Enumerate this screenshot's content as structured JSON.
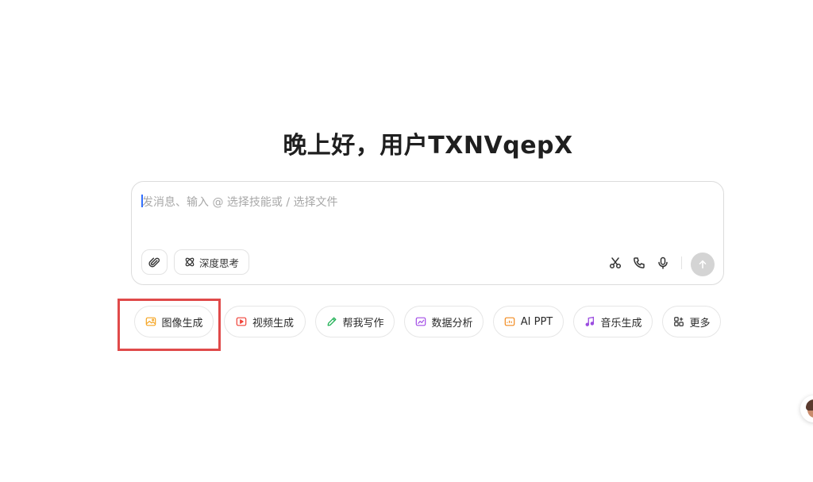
{
  "greeting": "晚上好，用户TXNVqepX",
  "composer": {
    "placeholder": "发消息、输入 @ 选择技能或 / 选择文件",
    "attach_icon": "paperclip-icon",
    "deep_think": {
      "label": "深度思考",
      "icon": "atom-icon"
    },
    "tools": [
      "scissors-icon",
      "phone-icon",
      "microphone-icon"
    ],
    "send_icon": "arrow-up-icon"
  },
  "chips": [
    {
      "label": "图像生成",
      "icon": "image-icon",
      "color": "#f5a524"
    },
    {
      "label": "视频生成",
      "icon": "video-icon",
      "color": "#f0443a"
    },
    {
      "label": "帮我写作",
      "icon": "pen-icon",
      "color": "#27b35a"
    },
    {
      "label": "数据分析",
      "icon": "chart-icon",
      "color": "#a34ee6"
    },
    {
      "label": "AI PPT",
      "icon": "slides-icon",
      "color": "#f28b20"
    },
    {
      "label": "音乐生成",
      "icon": "music-icon",
      "color": "#9b4de0"
    },
    {
      "label": "更多",
      "icon": "grid-icon",
      "color": "#333333"
    }
  ],
  "highlighted_chip": "图像生成"
}
